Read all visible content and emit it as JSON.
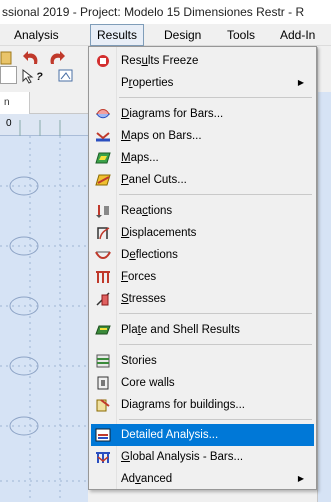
{
  "window": {
    "title": "ssional 2019 - Project: Modelo 15 Dimensiones Restr - R"
  },
  "menubar": {
    "items": [
      {
        "label": "Analysis"
      },
      {
        "label": "Results"
      },
      {
        "label": "Design"
      },
      {
        "label": "Tools"
      },
      {
        "label": "Add-In"
      }
    ]
  },
  "toolbar": {
    "combo_value": "?",
    "help_label": "?"
  },
  "left_panel": {
    "tab_label": "n",
    "ruler_label": "0"
  },
  "results_menu": {
    "items": [
      {
        "label": "Results Freeze",
        "icon": "results-freeze-icon",
        "accel": "u"
      },
      {
        "label": "Properties",
        "icon": "",
        "accel": "r",
        "submenu": true
      },
      {
        "label": "Diagrams for Bars...",
        "icon": "diagrams-bars-icon",
        "accel": "D"
      },
      {
        "label": "Maps on Bars...",
        "icon": "maps-on-bars-icon",
        "accel": "M"
      },
      {
        "label": "Maps...",
        "icon": "maps-icon",
        "accel": "M"
      },
      {
        "label": "Panel Cuts...",
        "icon": "panel-cuts-icon",
        "accel": "P"
      },
      {
        "label": "Reactions",
        "icon": "reactions-icon",
        "accel": "c"
      },
      {
        "label": "Displacements",
        "icon": "displacements-icon",
        "accel": "D"
      },
      {
        "label": "Deflections",
        "icon": "deflections-icon",
        "accel": "e"
      },
      {
        "label": "Forces",
        "icon": "forces-icon",
        "accel": "F"
      },
      {
        "label": "Stresses",
        "icon": "stresses-icon",
        "accel": "S"
      },
      {
        "label": "Plate and Shell Results",
        "icon": "plate-shell-icon",
        "accel": "t"
      },
      {
        "label": "Stories",
        "icon": "stories-icon",
        "accel": ""
      },
      {
        "label": "Core walls",
        "icon": "core-walls-icon",
        "accel": ""
      },
      {
        "label": "Diagrams for buildings...",
        "icon": "diagrams-buildings-icon",
        "accel": ""
      },
      {
        "label": "Detailed Analysis...",
        "icon": "detailed-analysis-icon",
        "accel": "",
        "highlighted": true
      },
      {
        "label": "Global Analysis - Bars...",
        "icon": "global-analysis-icon",
        "accel": "G"
      },
      {
        "label": "Advanced",
        "icon": "",
        "accel": "v",
        "submenu": true
      }
    ]
  },
  "colors": {
    "highlight": "#0078d7",
    "canvas": "#d6e3f5",
    "menu_bg": "#f0f0f0"
  }
}
